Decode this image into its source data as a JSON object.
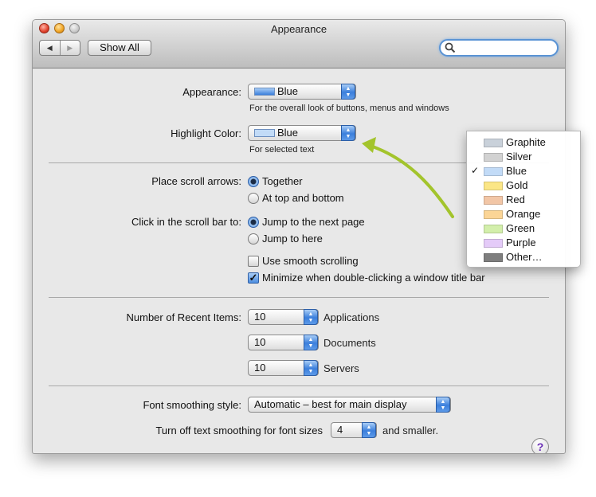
{
  "window": {
    "title": "Appearance"
  },
  "toolbar": {
    "back_label": "◀",
    "forward_label": "▶",
    "show_all_label": "Show All",
    "search_placeholder": ""
  },
  "appearance": {
    "label": "Appearance:",
    "value": "Blue",
    "note": "For the overall look of buttons, menus and windows"
  },
  "highlight": {
    "label": "Highlight Color:",
    "value": "Blue",
    "note": "For selected text"
  },
  "scroll_arrows": {
    "label": "Place scroll arrows:",
    "options": [
      "Together",
      "At top and bottom"
    ],
    "selected": "Together"
  },
  "scroll_click": {
    "label": "Click in the scroll bar to:",
    "options": [
      "Jump to the next page",
      "Jump to here"
    ],
    "selected": "Jump to the next page"
  },
  "checkboxes": {
    "smooth_scrolling": {
      "label": "Use smooth scrolling",
      "checked": false
    },
    "minimize_double_click": {
      "label": "Minimize when double-clicking a window title bar",
      "checked": true
    }
  },
  "recent_items": {
    "label": "Number of Recent Items:",
    "applications": {
      "value": "10",
      "label": "Applications"
    },
    "documents": {
      "value": "10",
      "label": "Documents"
    },
    "servers": {
      "value": "10",
      "label": "Servers"
    }
  },
  "font_smoothing": {
    "label": "Font smoothing style:",
    "value": "Automatic – best for main display"
  },
  "text_smoothing": {
    "label": "Turn off text smoothing for font sizes",
    "value": "4",
    "suffix": "and smaller."
  },
  "help": {
    "label": "?"
  },
  "color_menu": {
    "items": [
      {
        "label": "Graphite",
        "color": "#c9d1da",
        "checked": false
      },
      {
        "label": "Silver",
        "color": "#d2d2d2",
        "checked": false
      },
      {
        "label": "Blue",
        "color": "#c2dbf7",
        "checked": true
      },
      {
        "label": "Gold",
        "color": "#fbe686",
        "checked": false
      },
      {
        "label": "Red",
        "color": "#f2c6a6",
        "checked": false
      },
      {
        "label": "Orange",
        "color": "#fbd596",
        "checked": false
      },
      {
        "label": "Green",
        "color": "#d3efab",
        "checked": false
      },
      {
        "label": "Purple",
        "color": "#e4cbf8",
        "checked": false
      },
      {
        "label": "Other…",
        "color": "#7e7e7e",
        "checked": false
      }
    ],
    "check_glyph": "✓"
  },
  "colors": {
    "accent_blue": "#3b7fdc",
    "annotation_arrow": "#a3c42c",
    "help_icon": "#6a2fb5"
  }
}
